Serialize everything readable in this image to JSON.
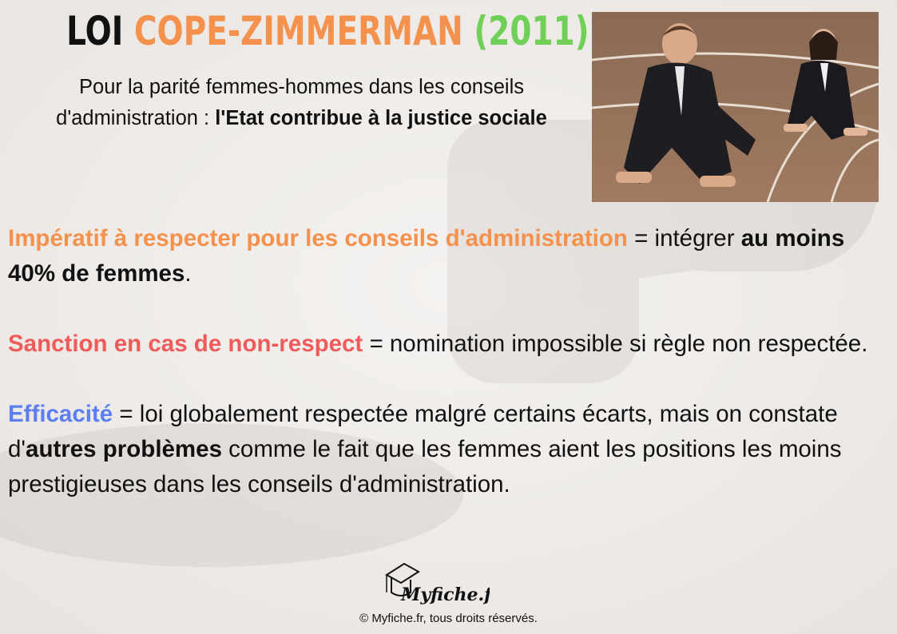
{
  "header": {
    "title_part1": "LOI",
    "title_part2": "COPE-ZIMMERMAN",
    "title_part3": "(2011)",
    "subtitle_line1": "Pour la parité femmes-hommes dans les conseils",
    "subtitle_line2_normal": "d'administration : ",
    "subtitle_line2_bold": "l'Etat contribue à la justice sociale"
  },
  "photo": {
    "icon": "business-people-starting-line-photo"
  },
  "sections": {
    "imperatif": {
      "keyword": "Impératif à respecter pour les conseils d'administration",
      "text1": " = intégrer ",
      "bold": "au moins 40% de femmes",
      "text2": "."
    },
    "sanction": {
      "keyword": "Sanction en cas de non-respect",
      "text": " = nomination impossible si règle non respectée."
    },
    "efficacite": {
      "keyword": "Efficacité",
      "text1": " = loi globalement respectée malgré certains écarts, mais on constate d'",
      "bold": "autres problèmes",
      "text2": " comme le fait que les femmes aient les positions les moins prestigieuses dans les conseils d'administration."
    }
  },
  "footer": {
    "logo_text": "Myfiche.fr",
    "copyright": "© Myfiche.fr, tous droits réservés."
  },
  "colors": {
    "orange": "#f4914c",
    "green": "#6fcf57",
    "red": "#ef5b5b",
    "blue": "#5b7ff0"
  }
}
